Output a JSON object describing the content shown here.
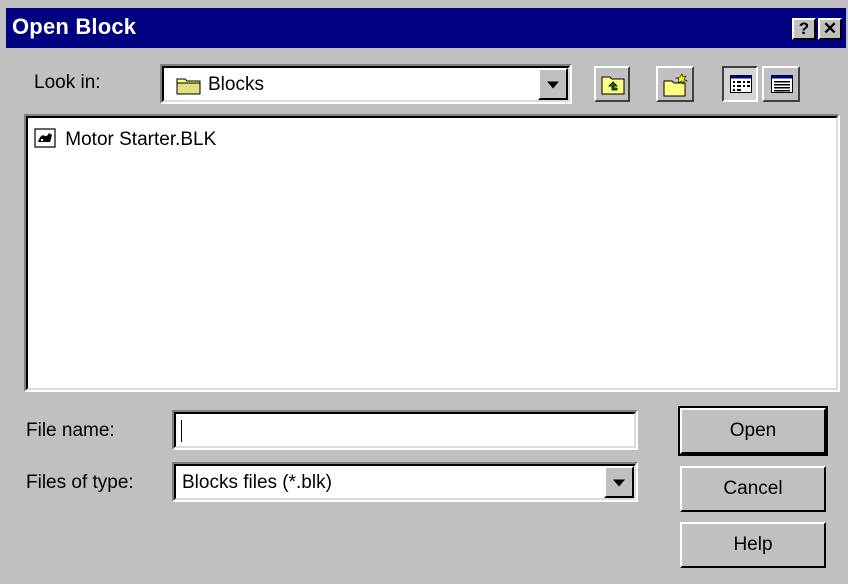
{
  "window": {
    "title": "Open Block",
    "help_label": "?",
    "close_label": "✕"
  },
  "look_in": {
    "label": "Look in:",
    "value": "Blocks"
  },
  "files": [
    {
      "name": "Motor Starter.BLK"
    }
  ],
  "file_name": {
    "label": "File name:",
    "value": ""
  },
  "files_of_type": {
    "label": "Files of type:",
    "value": "Blocks files (*.blk)"
  },
  "buttons": {
    "open": "Open",
    "cancel": "Cancel",
    "help": "Help"
  },
  "icons": {
    "folder": "folder-icon",
    "up_folder": "up-one-level-icon",
    "new_folder": "new-folder-icon",
    "list_view": "list-view-icon",
    "details_view": "details-view-icon",
    "file": "block-file-icon"
  }
}
